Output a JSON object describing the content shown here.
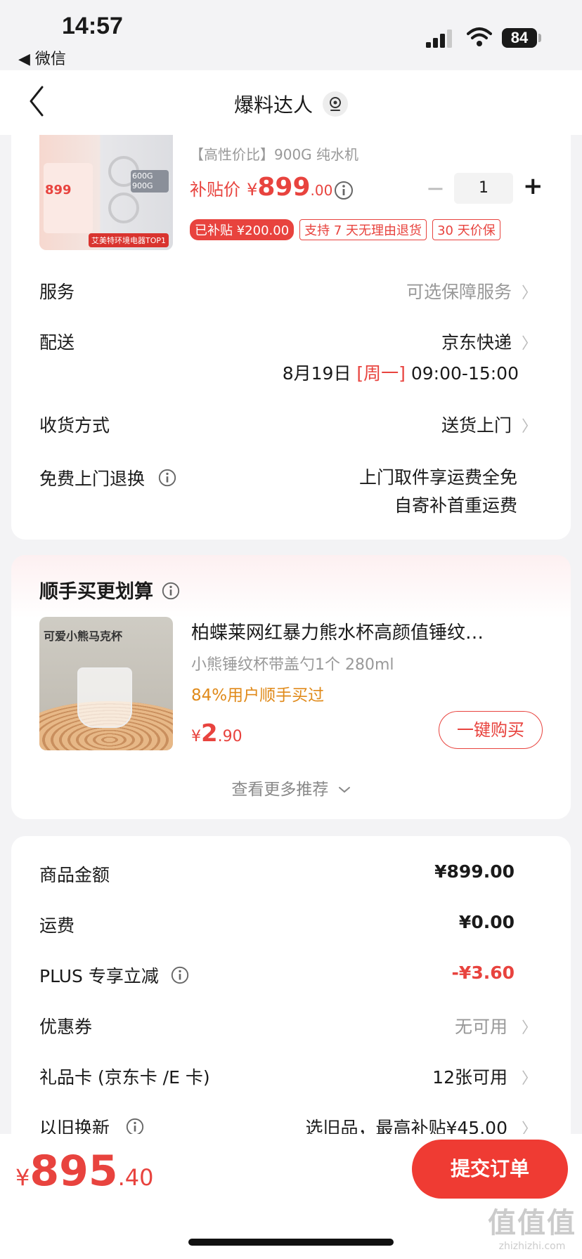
{
  "status": {
    "time": "14:57",
    "back_app": "◀ 微信",
    "battery": "84"
  },
  "nav": {
    "title": "爆料达人"
  },
  "product": {
    "subtitle": "【高性价比】900G 纯水机",
    "price_label": "补贴价",
    "price_symbol": "¥",
    "price_int": "899",
    "price_dec": ".00",
    "quantity": "1",
    "tags": [
      "已补贴 ¥200.00",
      "支持 7 天无理由退货",
      "30 天价保"
    ],
    "image_text": {
      "price": "899",
      "top": "艾美特环境电器TOP1",
      "badge": "600G 900G"
    }
  },
  "rows": {
    "service": {
      "label": "服务",
      "value": "可选保障服务"
    },
    "delivery": {
      "label": "配送",
      "value": "京东快递",
      "date": "8月19日",
      "weekday": "[周一]",
      "slot": "09:00-15:00"
    },
    "receive": {
      "label": "收货方式",
      "value": "送货上门"
    },
    "return": {
      "label": "免费上门退换",
      "line1": "上门取件享运费全免",
      "line2": "自寄补首重运费"
    }
  },
  "addon": {
    "title": "顺手买更划算",
    "item_title": "柏蝶莱网红暴力熊水杯高颜值锤纹…",
    "item_spec": "小熊锤纹杯带盖勺1个 280ml",
    "item_stat": "84%用户顺手买过",
    "price_symbol": "¥",
    "price_int": "2",
    "price_dec": ".90",
    "buy_label": "一键购买",
    "more_label": "查看更多推荐",
    "image_text": "可爱小熊马克杯"
  },
  "summary": {
    "goods_amount": {
      "label": "商品金额",
      "value": "¥899.00"
    },
    "shipping": {
      "label": "运费",
      "value": "¥0.00"
    },
    "plus": {
      "label": "PLUS 专享立减",
      "value": "-¥3.60"
    },
    "coupon": {
      "label": "优惠券",
      "value": "无可用"
    },
    "giftcard": {
      "label": "礼品卡 (京东卡 /E 卡)",
      "value": "12张可用"
    },
    "tradein": {
      "label": "以旧换新",
      "value": "选旧品，最高补贴¥45.00"
    }
  },
  "footer": {
    "symbol": "¥",
    "total_int": "895",
    "total_dec": ".40",
    "submit_label": "提交订单"
  },
  "watermark": {
    "text": "值值值",
    "domain": "zhizhizhi.com"
  },
  "colors": {
    "accent": "#ef3b33",
    "orange": "#e08a1a",
    "background": "#f3f3f5"
  }
}
